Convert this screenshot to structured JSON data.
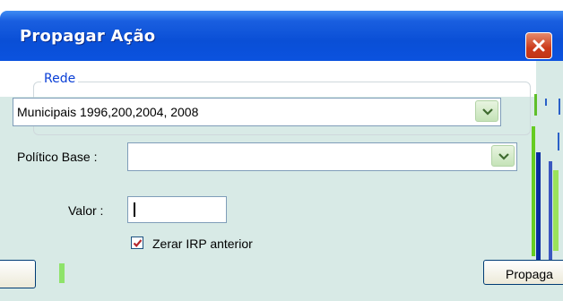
{
  "window": {
    "title": "Propagar Ação"
  },
  "group": {
    "legend": "Rede"
  },
  "rede": {
    "selected": "Municipais 1996,200,2004, 2008"
  },
  "politico": {
    "label": "Político Base :",
    "selected": ""
  },
  "valor": {
    "label": "Valor :",
    "value": ""
  },
  "zerar": {
    "label": "Zerar IRP anterior",
    "checked": true
  },
  "buttons": {
    "propagar": "Propaga"
  },
  "icons": {
    "close": "close-icon",
    "dropdown": "chevron-down-icon",
    "check": "checkmark-icon"
  },
  "colors": {
    "titlebar": "#0a4fd6",
    "panel": "#d8eae6",
    "close": "#cc3b1b",
    "legend": "#0a3fd6",
    "dropdown": "#c5e3b8"
  }
}
